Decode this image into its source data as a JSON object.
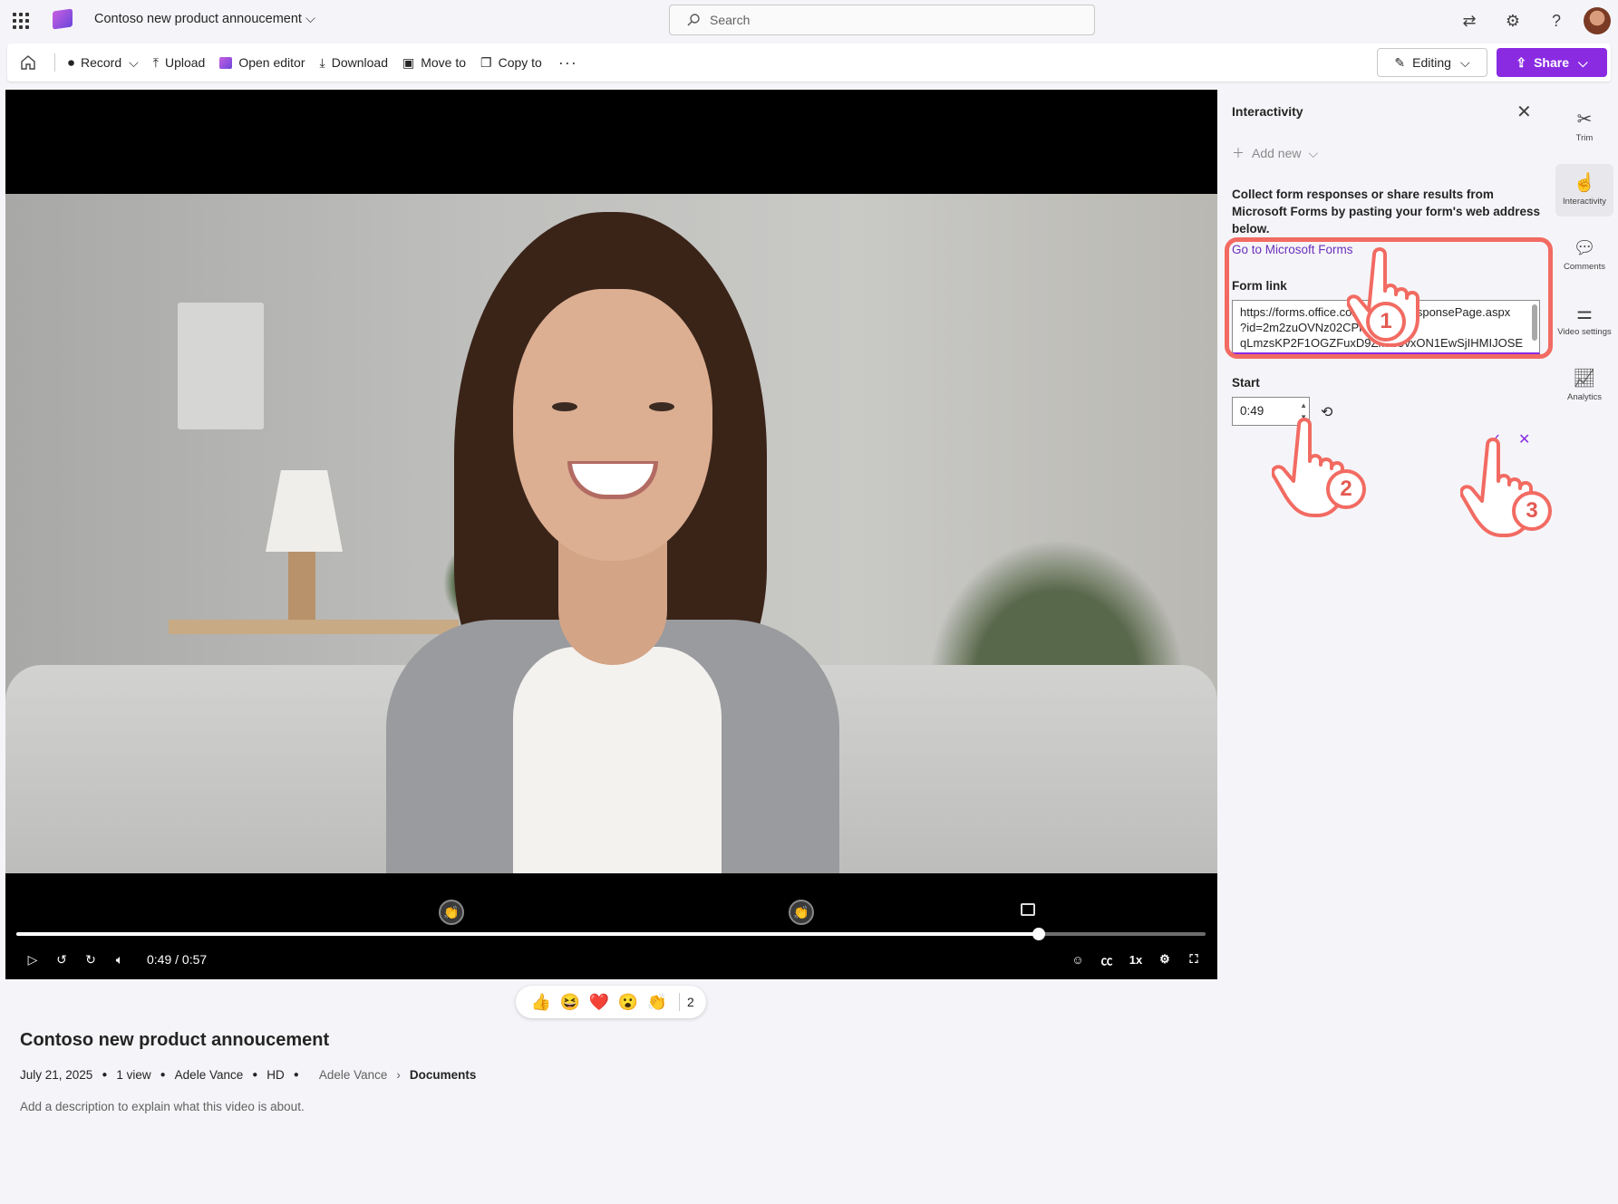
{
  "header": {
    "app_icon": "waffle-icon",
    "title": "Contoso new product annoucement",
    "search_placeholder": "Search"
  },
  "toolbar": {
    "record": "Record",
    "upload": "Upload",
    "open_editor": "Open editor",
    "download": "Download",
    "move_to": "Move to",
    "copy_to": "Copy to",
    "more": "···",
    "editing": "Editing",
    "share": "Share"
  },
  "player": {
    "time": "0:49 / 0:57",
    "progress": 0.86,
    "speed": "1x",
    "markers": [
      "clap",
      "clap",
      "form"
    ]
  },
  "reactions": {
    "items": [
      "👍",
      "😆",
      "❤️",
      "😮",
      "👏"
    ],
    "count": "2"
  },
  "video": {
    "title": "Contoso new product annoucement",
    "date": "July 21, 2025",
    "views": "1 view",
    "author": "Adele Vance",
    "quality": "HD",
    "crumb_owner": "Adele Vance",
    "crumb_folder": "Documents",
    "description": "Add a description to explain what this video is about."
  },
  "panel": {
    "title": "Interactivity",
    "add_new": "Add new",
    "description": "Collect form responses or share results from Microsoft Forms by pasting your form's web address below.",
    "link_text": "Go to Microsoft Forms",
    "form_link_label": "Form link",
    "form_link_lines": [
      "https://forms.office.com/Pages/ResponsePage.aspx",
      "?id=2m2zuOVNz02CPP0z",
      "qLmzsKP2F1OGZFuxD9ZMI09vxON1EwSjIHMIJOSE"
    ],
    "start_label": "Start",
    "start_value": "0:49",
    "steps": [
      "1",
      "2",
      "3"
    ]
  },
  "rail": {
    "items": [
      "Trim",
      "Interactivity",
      "Comments",
      "Video settings",
      "Analytics"
    ],
    "selected": "Interactivity"
  },
  "colors": {
    "accent": "#8a2be2",
    "highlight": "#f26b62"
  }
}
